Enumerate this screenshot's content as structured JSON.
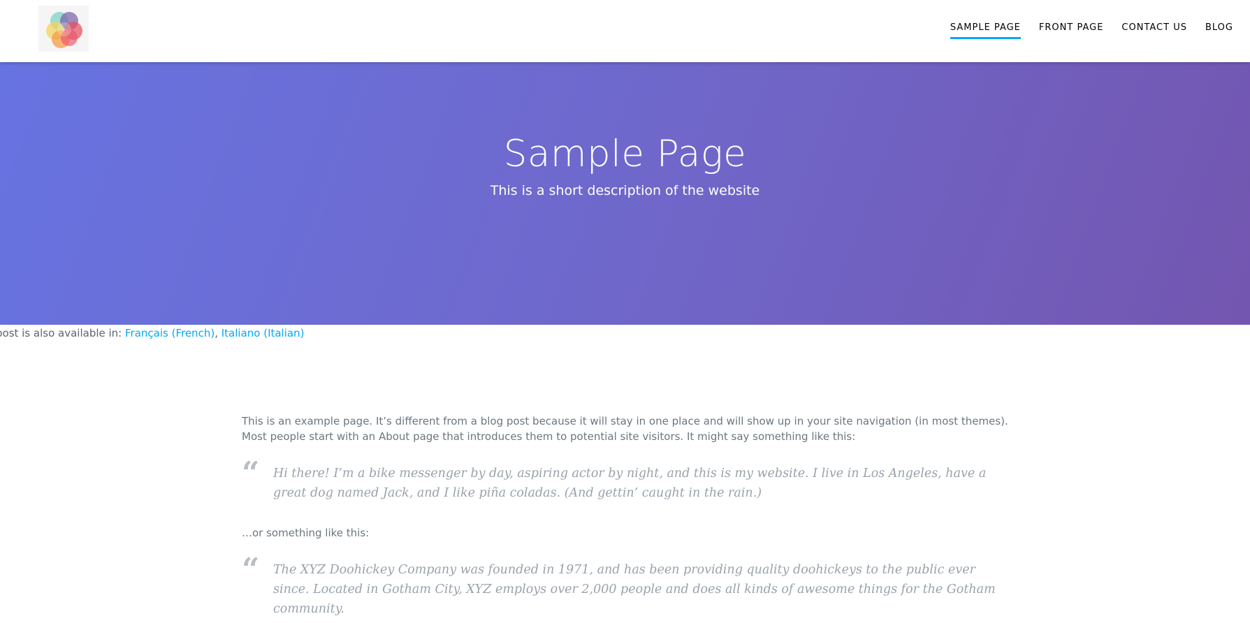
{
  "nav": {
    "items": [
      {
        "label": "SAMPLE PAGE",
        "active": true
      },
      {
        "label": "FRONT PAGE",
        "active": false
      },
      {
        "label": "CONTACT US",
        "active": false
      },
      {
        "label": "BLOG",
        "active": false
      }
    ]
  },
  "hero": {
    "title": "Sample Page",
    "subtitle": "This is a short description of the website"
  },
  "languages": {
    "prefix": "post is also available in: ",
    "links": [
      "Français (French)",
      "Italiano (Italian)"
    ],
    "separator": ", "
  },
  "content": {
    "intro": "This is an example page. It’s different from a blog post because it will stay in one place and will show up in your site navigation (in most themes). Most people start with an About page that introduces them to potential site visitors. It might say something like this:",
    "quote1": "Hi there! I’m a bike messenger by day, aspiring actor by night, and this is my website. I live in Los Angeles, have a great dog named Jack, and I like piña coladas. (And gettin’ caught in the rain.)",
    "between": "…or something like this:",
    "quote2": "The XYZ Doohickey Company was founded in 1971, and has been providing quality doohickeys to the public ever since. Located in Gotham City, XYZ employs over 2,000 people and does all kinds of awesome things for the Gotham community.",
    "quote_mark": "“"
  },
  "colors": {
    "accent": "#03a9f4",
    "hero_gradient_start": "#6773e1",
    "hero_gradient_end": "#7356b0"
  }
}
